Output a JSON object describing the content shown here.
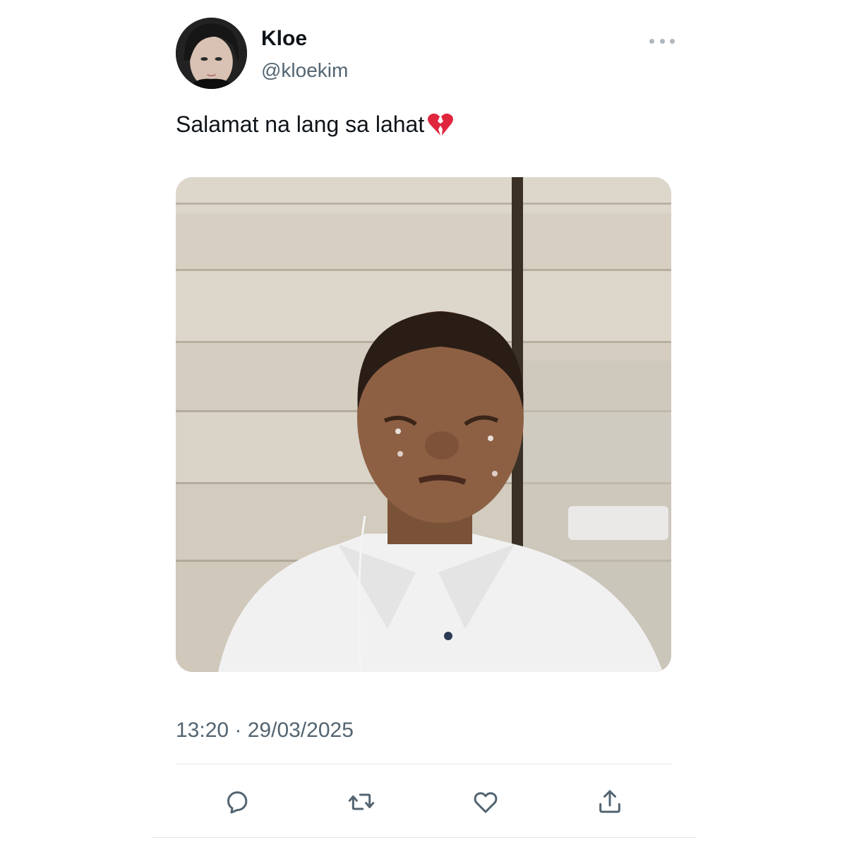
{
  "tweet": {
    "author": {
      "display_name": "Kloe",
      "handle": "@kloekim"
    },
    "text": "Salamat na lang sa lahat",
    "emoji": "broken-heart-icon",
    "timestamp": "13:20 · 29/03/2025"
  },
  "actions": [
    {
      "name": "reply",
      "icon": "reply-icon"
    },
    {
      "name": "retweet",
      "icon": "retweet-icon"
    },
    {
      "name": "like",
      "icon": "heart-icon"
    },
    {
      "name": "share",
      "icon": "share-icon"
    }
  ],
  "colors": {
    "text": "#0f1419",
    "secondary": "#536471",
    "divider": "#e1e6ea",
    "icon": "#536471",
    "broken_heart": "#e0263c"
  }
}
